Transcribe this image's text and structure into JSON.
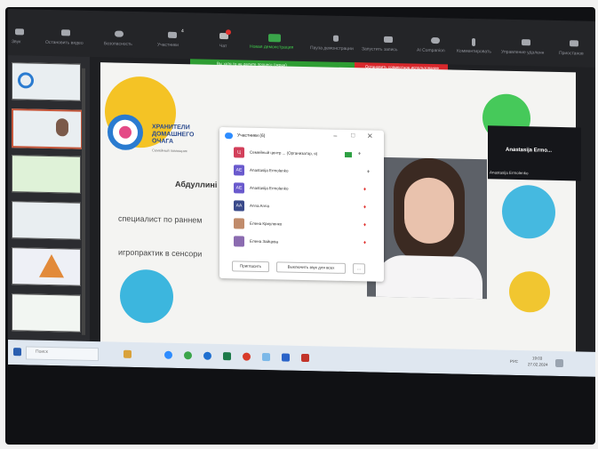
{
  "toolbar": {
    "items": [
      {
        "label": "Звук",
        "icon": "microphone-icon"
      },
      {
        "label": "Остановить видео",
        "icon": "camera-icon"
      },
      {
        "label": "Безопасность",
        "icon": "shield-icon"
      },
      {
        "label": "Участники",
        "count": "4",
        "icon": "participants-icon"
      },
      {
        "label": "Чат",
        "icon": "chat-icon"
      },
      {
        "label": "Новая демонстрация",
        "icon": "share-screen-icon"
      },
      {
        "label": "Пауза демонстрации",
        "icon": "pause-icon"
      },
      {
        "label": "Запустить запись",
        "icon": "record-icon"
      },
      {
        "label": "AI Companion",
        "icon": "ai-companion-icon"
      },
      {
        "label": "Комментировать",
        "icon": "annotate-icon"
      },
      {
        "label": "Управление удаленн",
        "icon": "remote-control-icon"
      },
      {
        "label": "Приостанов",
        "icon": "more-icon"
      }
    ]
  },
  "share_bar": {
    "text": "Вы хотя то не делите процесс (экран)",
    "stop_label": "Остановить совместное использование"
  },
  "slide": {
    "logo_line1": "ХРАНИТЕЛИ",
    "logo_line2": "ДОМАШНЕГО",
    "logo_line3": "ОЧАГА",
    "logo_sub": "Семейный помощник",
    "name_text": "Абдуллинi",
    "role_text": "специалист по раннем",
    "role2_text": "игропрактик в сенсори"
  },
  "participants_panel": {
    "title": "Участники (6)",
    "rows": [
      {
        "name": "Семейный центр ... (Организатор, я)",
        "initials": "Ц",
        "color": "#d23f5a"
      },
      {
        "name": "Anastasija Ermolenko",
        "initials": "AE",
        "color": "#6a5acd"
      },
      {
        "name": "Anastasija Ermolenko",
        "initials": "AE",
        "color": "#6a5acd"
      },
      {
        "name": "Anna Anna",
        "initials": "AA",
        "color": "#3a4a8a"
      },
      {
        "name": "Елена Криуленко",
        "initials": "",
        "color": "#c08b6b"
      },
      {
        "name": "Елена Зайцева",
        "initials": "",
        "color": "#8b6bb0"
      }
    ],
    "invite_label": "Пригласить",
    "mute_all_label": "Выключить звук для всех",
    "more_label": "..."
  },
  "name_tile": {
    "title": "Anastasija Ermo...",
    "subtitle": "Anastasija Ermolenko"
  },
  "taskbar": {
    "search_placeholder": "Поиск",
    "tray_lang": "РУС",
    "tray_time": "19:03",
    "tray_date": "27.02.2024"
  }
}
